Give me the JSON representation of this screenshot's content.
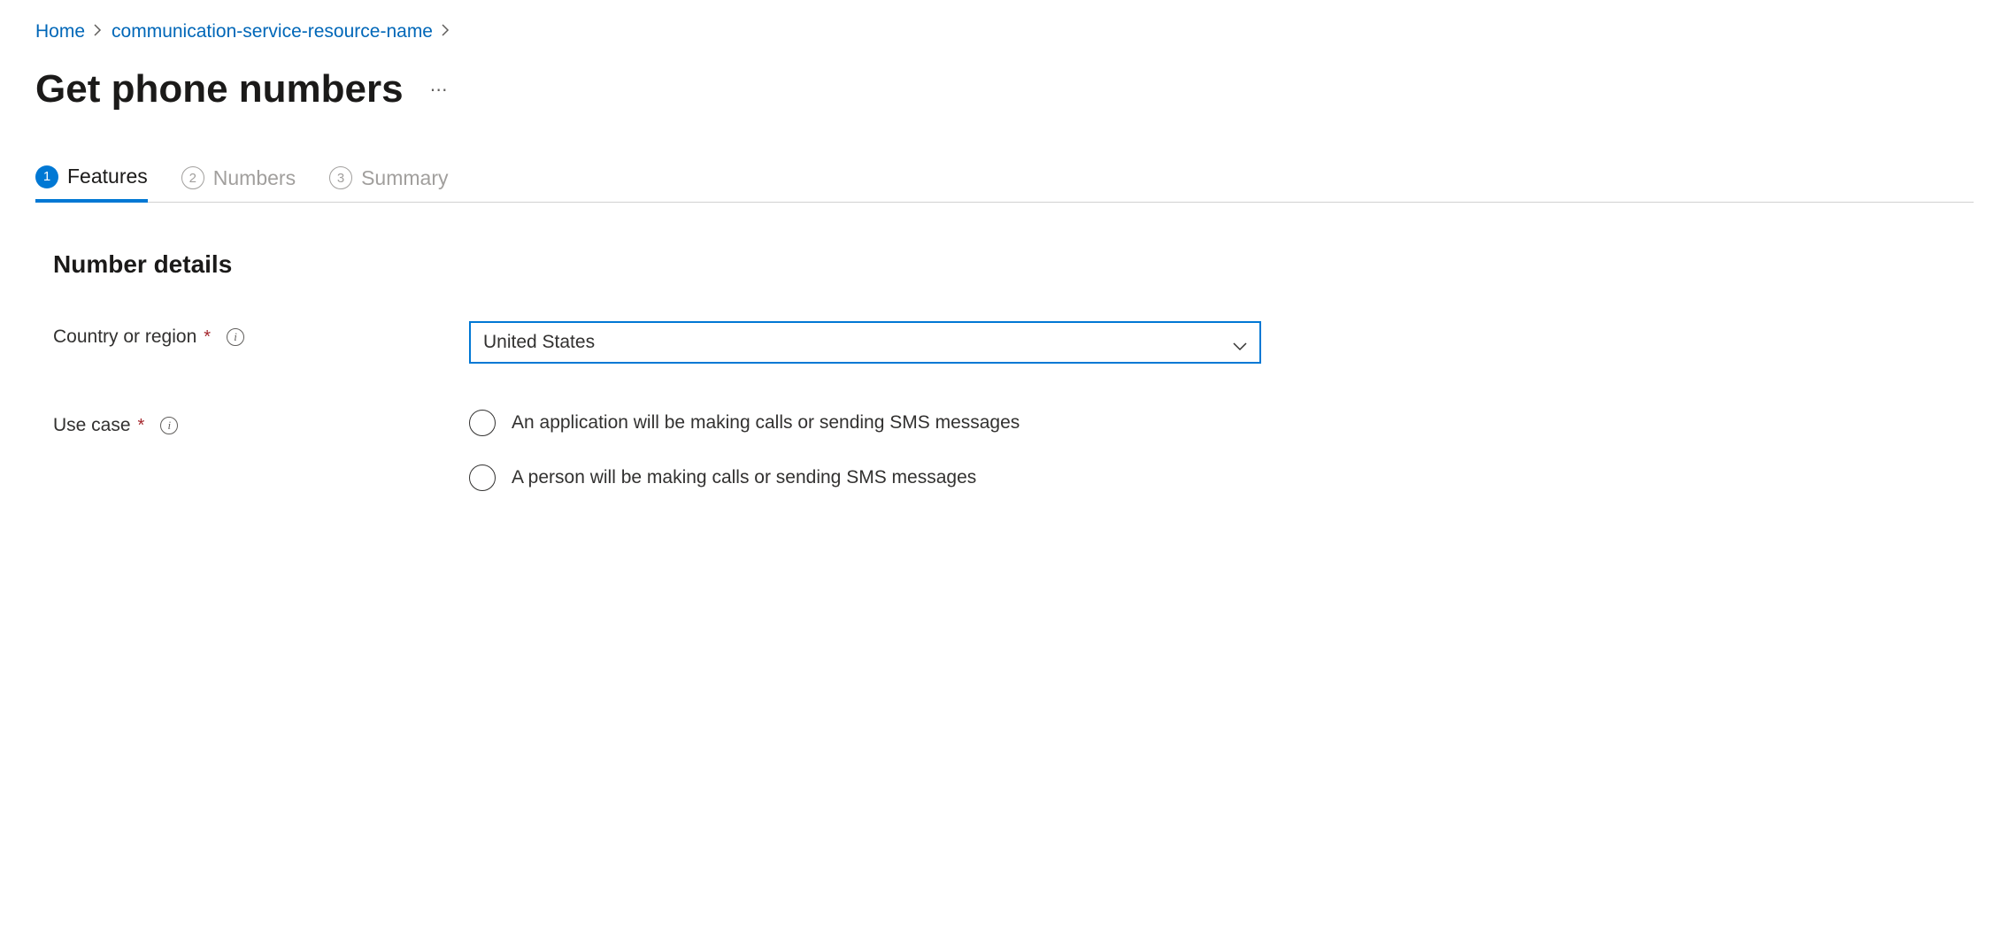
{
  "breadcrumb": {
    "home": "Home",
    "resource": "communication-service-resource-name"
  },
  "header": {
    "title": "Get phone numbers"
  },
  "tabs": [
    {
      "num": "1",
      "label": "Features",
      "active": true
    },
    {
      "num": "2",
      "label": "Numbers",
      "active": false
    },
    {
      "num": "3",
      "label": "Summary",
      "active": false
    }
  ],
  "section": {
    "title": "Number details",
    "fields": {
      "country": {
        "label": "Country or region",
        "value": "United States"
      },
      "usecase": {
        "label": "Use case",
        "options": [
          "An application will be making calls or sending SMS messages",
          "A person will be making calls or sending SMS messages"
        ]
      }
    }
  }
}
